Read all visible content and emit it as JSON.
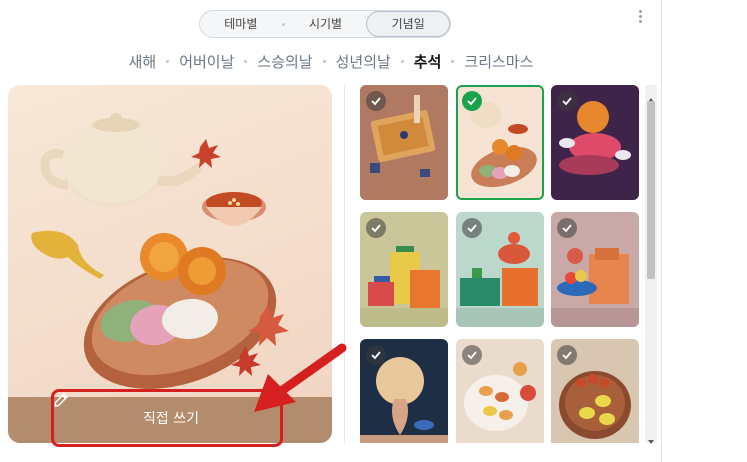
{
  "tabs": [
    {
      "label": "테마별"
    },
    {
      "label": "시기별"
    },
    {
      "label": "기념일"
    }
  ],
  "holidays": [
    {
      "label": "새해"
    },
    {
      "label": "어버이날"
    },
    {
      "label": "스승의날"
    },
    {
      "label": "성년의날"
    },
    {
      "label": "추석"
    },
    {
      "label": "크리스마스"
    }
  ],
  "preview": {
    "write_button_label": "직접 쓰기",
    "icon": "pencil-icon"
  },
  "thumbnails": [
    {
      "name": "scroll-paper",
      "selected": false
    },
    {
      "name": "teapot-songpyeon",
      "selected": true
    },
    {
      "name": "ribbon-cake",
      "selected": false
    },
    {
      "name": "gift-boxes-olive",
      "selected": false
    },
    {
      "name": "gift-boxes-mint",
      "selected": false
    },
    {
      "name": "fruit-bowl-mauve",
      "selected": false
    },
    {
      "name": "full-moon-vase",
      "selected": false
    },
    {
      "name": "persimmon-plate",
      "selected": false
    },
    {
      "name": "jeon-platter",
      "selected": false
    }
  ],
  "colors": {
    "accent_green": "#1aa34a",
    "highlight_red": "#d61f1f",
    "bar_brown": "#b38c6e"
  }
}
